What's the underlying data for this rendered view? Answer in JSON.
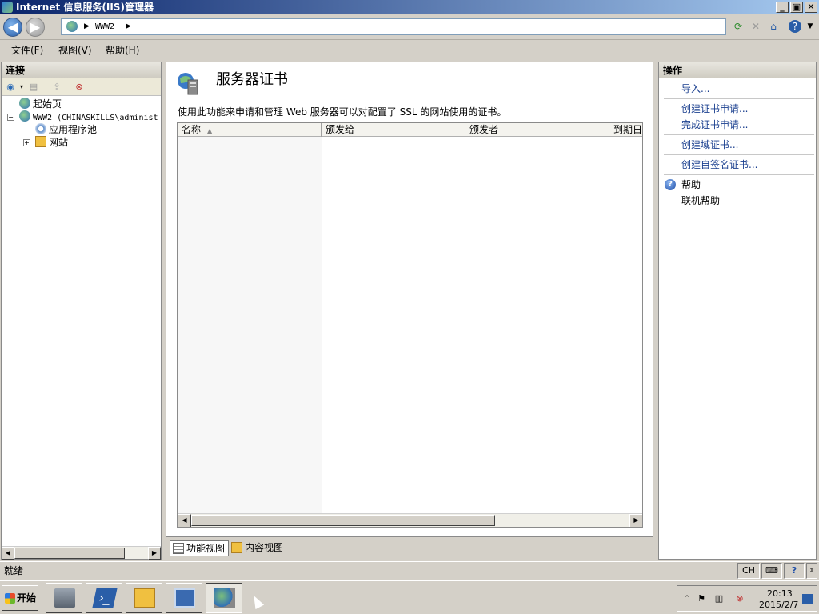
{
  "window": {
    "title": "Internet 信息服务(IIS)管理器"
  },
  "address": {
    "breadcrumb": "WWW2",
    "separator": "▶"
  },
  "menu": {
    "file": "文件(F)",
    "view": "视图(V)",
    "help": "帮助(H)"
  },
  "connections": {
    "header": "连接",
    "tree": [
      {
        "label": "起始页"
      },
      {
        "label": "WWW2 (CHINASKILLS\\administ"
      },
      {
        "label": "应用程序池"
      },
      {
        "label": "网站"
      }
    ]
  },
  "main": {
    "title": "服务器证书",
    "description": "使用此功能来申请和管理 Web 服务器可以对配置了 SSL 的网站使用的证书。",
    "columns": [
      "名称",
      "颁发给",
      "颁发者",
      "到期日"
    ],
    "sort_arrow": "▲",
    "views": {
      "features": "功能视图",
      "content": "内容视图"
    }
  },
  "actions": {
    "header": "操作",
    "items": [
      {
        "label": "导入..."
      },
      {
        "label": "创建证书申请..."
      },
      {
        "label": "完成证书申请..."
      },
      {
        "label": "创建域证书..."
      },
      {
        "label": "创建自签名证书..."
      },
      {
        "label": "帮助"
      },
      {
        "label": "联机帮助"
      }
    ]
  },
  "status": {
    "text": "就绪",
    "ime": "CH"
  },
  "taskbar": {
    "start": "开始",
    "clock_time": "20:13",
    "clock_date": "2015/2/7"
  },
  "icons": {
    "app": "iis-manager-icon",
    "back": "back-arrow-icon",
    "forward": "forward-arrow-icon",
    "help": "help-icon"
  }
}
